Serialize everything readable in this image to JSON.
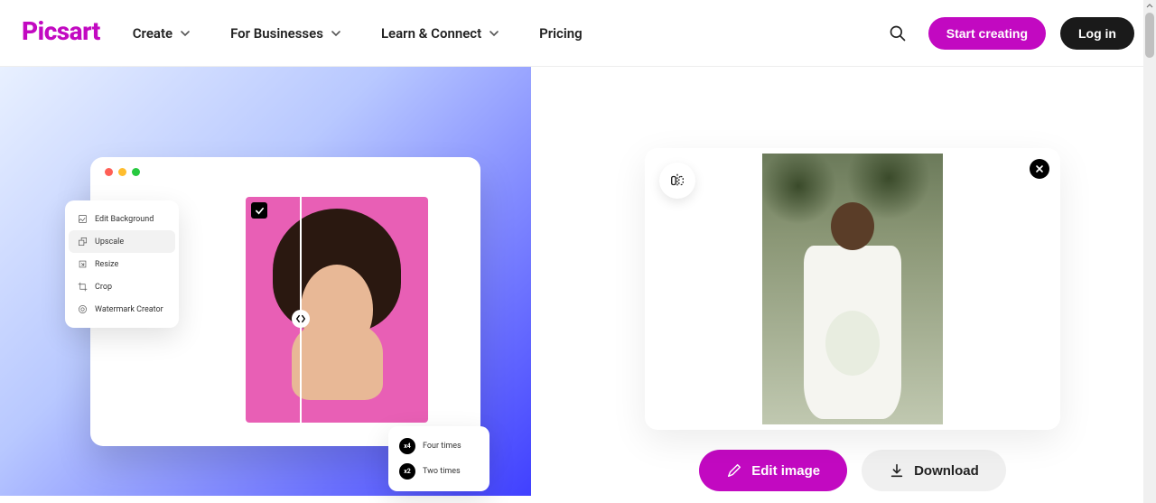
{
  "brand": "Picsart",
  "nav": {
    "items": [
      {
        "label": "Create"
      },
      {
        "label": "For Businesses"
      },
      {
        "label": "Learn & Connect"
      },
      {
        "label": "Pricing"
      }
    ]
  },
  "header_cta": {
    "start": "Start creating",
    "login": "Log in"
  },
  "promo": {
    "menu": [
      {
        "label": "Edit Background",
        "icon": "edit-bg"
      },
      {
        "label": "Upscale",
        "icon": "upscale",
        "active": true
      },
      {
        "label": "Resize",
        "icon": "resize"
      },
      {
        "label": "Crop",
        "icon": "crop"
      },
      {
        "label": "Watermark Creator",
        "icon": "watermark"
      }
    ],
    "options": [
      {
        "badge": "x4",
        "label": "Four times"
      },
      {
        "badge": "x2",
        "label": "Two times"
      }
    ]
  },
  "result": {
    "actions": {
      "edit": "Edit image",
      "download": "Download"
    }
  }
}
